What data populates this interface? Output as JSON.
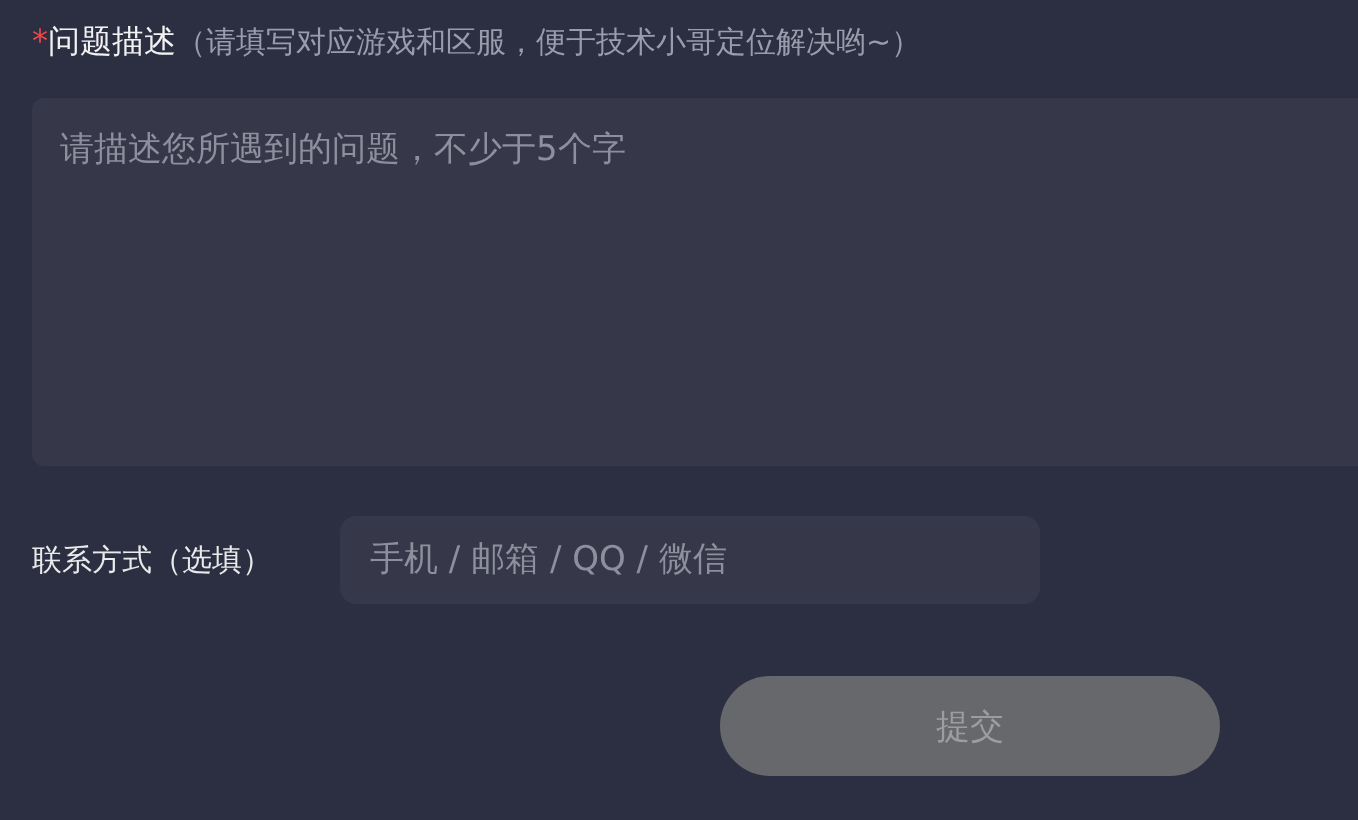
{
  "description": {
    "required_mark": "*",
    "label": "问题描述",
    "hint": "（请填写对应游戏和区服，便于技术小哥定位解决哟~）",
    "placeholder": "请描述您所遇到的问题，不少于5个字"
  },
  "contact": {
    "label": "联系方式（选填）",
    "placeholder": "手机 / 邮箱 / QQ / 微信"
  },
  "submit": {
    "label": "提交",
    "disabled": true
  }
}
